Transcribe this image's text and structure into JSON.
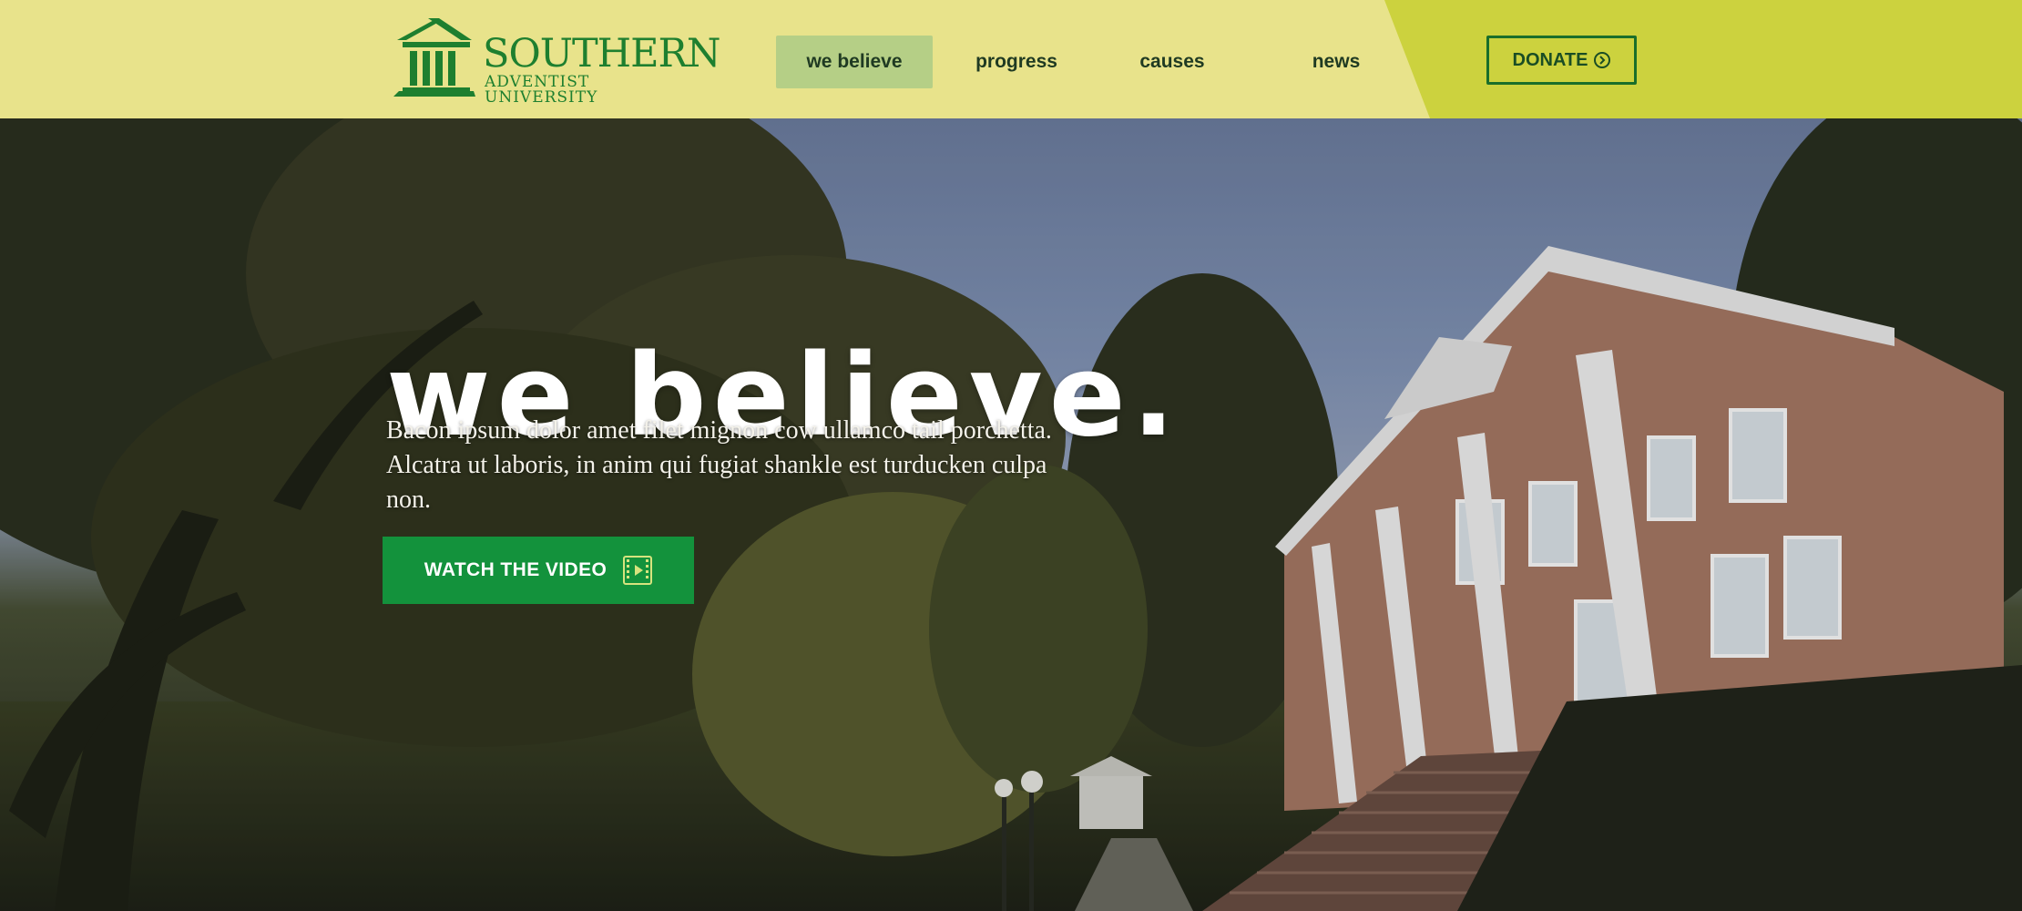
{
  "brand": {
    "name_top": "SOUTHERN",
    "name_bottom": "ADVENTIST UNIVERSITY",
    "logo_icon": "columns-building-icon"
  },
  "nav": {
    "items": [
      {
        "label": "we believe",
        "active": true
      },
      {
        "label": "progress",
        "active": false
      },
      {
        "label": "causes",
        "active": false
      },
      {
        "label": "news",
        "active": false
      }
    ]
  },
  "donate": {
    "label": "DONATE",
    "icon": "chevron-right-circle-icon"
  },
  "hero": {
    "title": "we believe.",
    "body": "Bacon ipsum dolor amet filet mignon cow ullamco tail porchetta. Alcatra ut laboris, in anim qui fugiat shankle est turducken culpa non.",
    "cta_label": "WATCH THE VIDEO",
    "cta_icon": "film-play-icon"
  },
  "colors": {
    "header_bg": "#e8e38b",
    "header_accent": "#ccd23e",
    "brand_green": "#1e7f2f",
    "cta_green": "#13923c",
    "nav_active_bg": "#b5cf86"
  }
}
